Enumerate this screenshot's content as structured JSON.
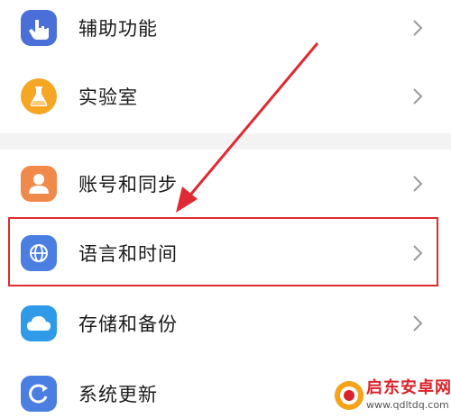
{
  "settings": {
    "items": [
      {
        "label": "辅助功能",
        "icon": "hand-icon",
        "color": "#4b6fd9"
      },
      {
        "label": "实验室",
        "icon": "flask-icon",
        "color": "#f5a623"
      },
      {
        "label": "账号和同步",
        "icon": "person-icon",
        "color": "#f08a4b"
      },
      {
        "label": "语言和时间",
        "icon": "globe-icon",
        "color": "#4a7ee0"
      },
      {
        "label": "存储和备份",
        "icon": "cloud-icon",
        "color": "#2f9be8"
      },
      {
        "label": "系统更新",
        "icon": "refresh-icon",
        "color": "#4a7ee0"
      }
    ]
  },
  "annotation": {
    "highlight_color": "#e02a31"
  },
  "watermark": {
    "title": "启东安卓网",
    "url": "www.qdltdq.com",
    "color": "#d9232a"
  }
}
